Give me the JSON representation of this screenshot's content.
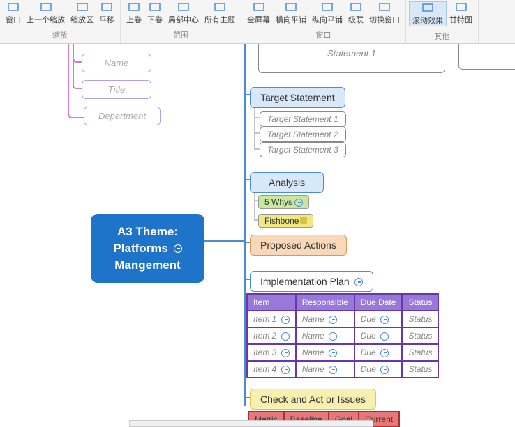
{
  "ribbon": {
    "groups": [
      {
        "label": "缩放",
        "items": [
          {
            "label": "窗口",
            "icon": "zoom"
          },
          {
            "label": "上一个缩放",
            "icon": "zoom-prev"
          },
          {
            "label": "缩放区",
            "icon": "zoom-area"
          },
          {
            "label": "平移",
            "icon": "pan"
          }
        ]
      },
      {
        "label": "范围",
        "items": [
          {
            "label": "上卷",
            "icon": "roll-up"
          },
          {
            "label": "下卷",
            "icon": "roll-down"
          },
          {
            "label": "局部中心",
            "icon": "center"
          },
          {
            "label": "所有主题",
            "icon": "all-topics"
          }
        ]
      },
      {
        "label": "窗口",
        "items": [
          {
            "label": "全屏幕",
            "icon": "fullscreen"
          },
          {
            "label": "横向平铺",
            "icon": "tile-h"
          },
          {
            "label": "纵向平铺",
            "icon": "tile-v"
          },
          {
            "label": "级联",
            "icon": "cascade"
          },
          {
            "label": "切换窗口",
            "icon": "switch"
          }
        ]
      },
      {
        "label": "其他",
        "items": [
          {
            "label": "滚动效果",
            "icon": "scroll-fx",
            "highlighted": true
          },
          {
            "label": "甘特图",
            "icon": "gantt"
          }
        ]
      }
    ]
  },
  "central": {
    "line1": "A3 Theme:",
    "line2": "Platforms",
    "line3": "Mangement"
  },
  "faded_nodes": [
    {
      "text": "Name"
    },
    {
      "text": "Title"
    },
    {
      "text": "Department"
    }
  ],
  "stmt_top": "Statement 1",
  "target": {
    "title": "Target  Statement",
    "items": [
      "Target Statement 1",
      "Target Statement 2",
      "Target Statement 3"
    ]
  },
  "analysis": {
    "title": "Analysis",
    "items": [
      "5 Whys",
      "Fishbone"
    ]
  },
  "proposed": "Proposed Actions",
  "implementation": {
    "title": "Implementation  Plan",
    "headers": [
      "Item",
      "Responsible",
      "Due Date",
      "Status"
    ],
    "rows": [
      [
        "Item 1",
        "Name",
        "Due",
        "Status"
      ],
      [
        "Item 2",
        "Name",
        "Due",
        "Status"
      ],
      [
        "Item 3",
        "Name",
        "Due",
        "Status"
      ],
      [
        "Item 4",
        "Name",
        "Due",
        "Status"
      ]
    ]
  },
  "check": "Check and Act or Issues",
  "metric_headers": [
    "Metric",
    "Baseline",
    "Goal",
    "Current"
  ]
}
